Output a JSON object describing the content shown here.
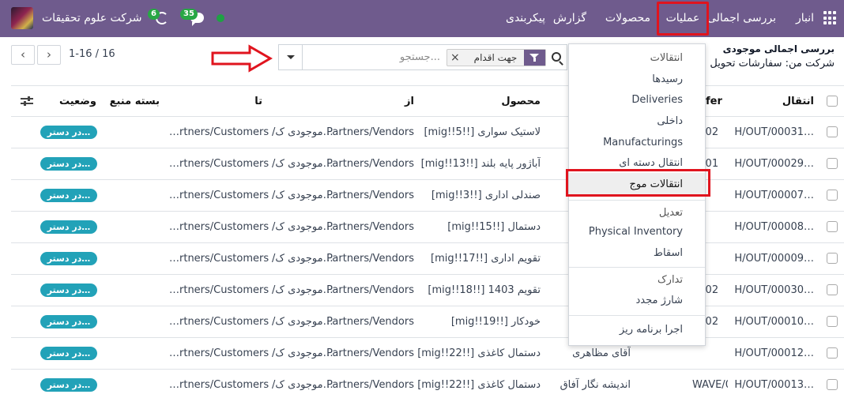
{
  "navbar": {
    "brand": "انبار",
    "items": [
      "بررسی اجمالی",
      "عملیات",
      "محصولات",
      "گزارش",
      "پیکربندی"
    ],
    "company": "شرکت علوم تحقیقات",
    "activity_count": "6",
    "chat_count": "35"
  },
  "breadcrumb": {
    "title": "بررسی اجمالی موجودی",
    "subtitle": "شرکت من: سفارشات تحویل"
  },
  "search": {
    "placeholder": "جستجو...",
    "facet": "جهت اقدام"
  },
  "pager": {
    "value": "1-16 / 16",
    "prev": "‹",
    "next": "›"
  },
  "table": {
    "columns": {
      "transfer": "انتقال",
      "transfer_partial": "nsfer",
      "product": "محصول",
      "from": "از",
      "to": "تا",
      "source_package": "بسته منبع",
      "status": "وضعیت"
    },
    "rows": [
      {
        "ref": "H/OUT/00031…",
        "ref2": "0002",
        "contact": "",
        "product": "[mig!!5!!] لاستیک سواری",
        "from": "Partners/Vendors",
        "from_loc": "/موجودی ک…",
        "to": "…rtners/Customers",
        "status": "در دستر…"
      },
      {
        "ref": "H/OUT/00029…",
        "ref2": "0001",
        "contact": "",
        "product": "[mig!!13!!] آباژور پایه بلند",
        "from": "Partners/Vendors",
        "from_loc": "/موجودی ک…",
        "to": "…rtners/Customers",
        "status": "در دستر…"
      },
      {
        "ref": "H/OUT/00007…",
        "ref2": "",
        "contact": "",
        "product": "[mig!!3!!] صندلی اداری",
        "from": "Partners/Vendors",
        "from_loc": "/موجودی ک…",
        "to": "…rtners/Customers",
        "status": "در دستر…"
      },
      {
        "ref": "H/OUT/00008…",
        "ref2": "",
        "contact": "",
        "product": "[mig!!15!!] دستمال",
        "from": "Partners/Vendors",
        "from_loc": "/موجودی ک…",
        "to": "…rtners/Customers",
        "status": "در دستر…"
      },
      {
        "ref": "H/OUT/00009…",
        "ref2": "",
        "contact": "…پ",
        "product": "[mig!!17!!] تقویم اداری",
        "from": "Partners/Vendors",
        "from_loc": "/موجودی ک…",
        "to": "…rtners/Customers",
        "status": "در دستر…"
      },
      {
        "ref": "H/OUT/00030…",
        "ref2": "0002",
        "contact": "…پ",
        "product": "[mig!!18!!] تقویم 1403",
        "from": "Partners/Vendors",
        "from_loc": "/موجودی ک…",
        "to": "…rtners/Customers",
        "status": "در دستر…"
      },
      {
        "ref": "H/OUT/00010…",
        "ref2": "0002",
        "contact": "",
        "product": "[mig!!19!!] خودکار",
        "from": "Partners/Vendors",
        "from_loc": "/موجودی ک…",
        "to": "…rtners/Customers",
        "status": "در دستر…"
      },
      {
        "ref": "H/OUT/00012…",
        "ref2": "",
        "contact": "آقای مظاهری",
        "product": "[mig!!22!!] دستمال کاغذی",
        "from": "Partners/Vendors",
        "from_loc": "/موجودی ک…",
        "to": "…rtners/Customers",
        "status": "در دستر…"
      },
      {
        "ref": "H/OUT/00013…",
        "ref2": "WAVE/00002",
        "contact": "اندیشه نگار آفاق",
        "product": "[mig!!22!!] دستمال کاغذی",
        "from": "Partners/Vendors",
        "from_loc": "/موجودی ک…",
        "to": "…rtners/Customers",
        "status": "در دستر…"
      }
    ]
  },
  "dropdown": {
    "transfers_header": "انتقالات",
    "receipts": "رسیدها",
    "deliveries": "Deliveries",
    "internal": "داخلی",
    "manufacturings": "Manufacturings",
    "batch_transfers": "انتقال دسته ای",
    "wave_transfers": "انتقالات موج",
    "adjustment_header": "تعدیل",
    "physical_inventory": "Physical Inventory",
    "scrap": "اسقاط",
    "procurement_header": "تدارک",
    "replenishment": "شارژ مجدد",
    "run_scheduler": "اجرا برنامه ریز"
  },
  "colors": {
    "navbar": "#6f5b8d",
    "status_pill": "#22a2b8",
    "annotation_red": "#e0141e",
    "badge_green": "#28a745"
  }
}
